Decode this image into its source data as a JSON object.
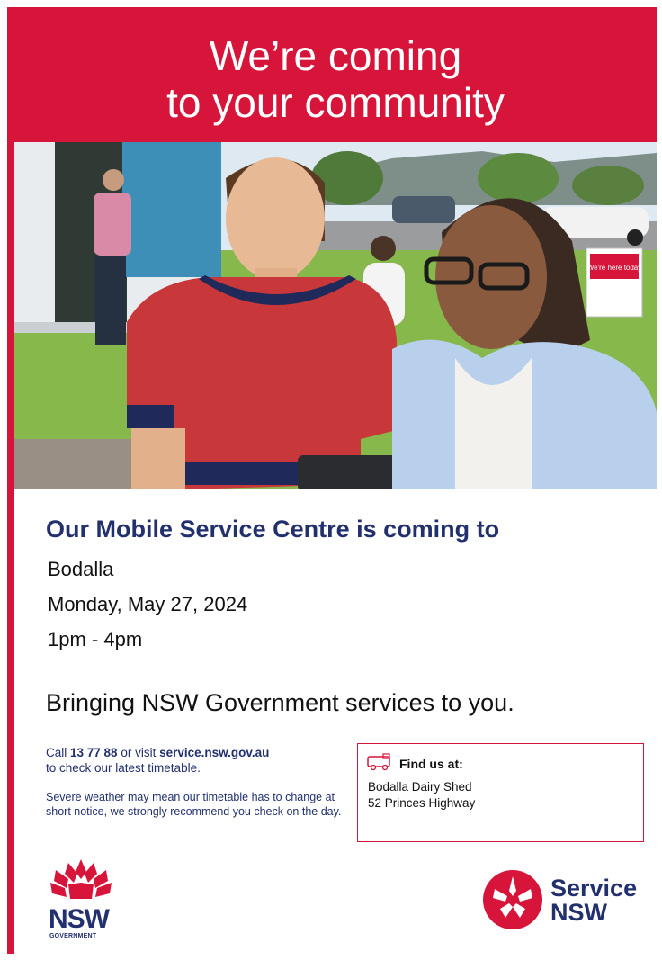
{
  "banner": {
    "line1": "We’re coming",
    "line2": "to your community"
  },
  "photo": {
    "sign_text": "We're here today"
  },
  "event": {
    "heading": "Our Mobile Service Centre is coming to",
    "location": "Bodalla",
    "date": "Monday, May 27, 2024",
    "time": "1pm - 4pm"
  },
  "tagline": "Bringing NSW Government services to you.",
  "contact": {
    "call_prefix": "Call ",
    "phone": "13 77 88",
    "visit_text": " or visit ",
    "website": "service.nsw.gov.au",
    "suffix": "to check our latest timetable.",
    "weather_note": "Severe weather may mean our timetable has to change at short notice, we strongly recommend you check on the day."
  },
  "find_us": {
    "icon": "bus-icon",
    "title": "Find us at:",
    "venue": "Bodalla Dairy Shed",
    "address": "52 Princes Highway"
  },
  "logos": {
    "nsw_word": "NSW",
    "nsw_sub": "GOVERNMENT",
    "service_line1": "Service",
    "service_line2": "NSW"
  },
  "colors": {
    "brand_red": "#d7153a",
    "navy": "#22306e"
  }
}
